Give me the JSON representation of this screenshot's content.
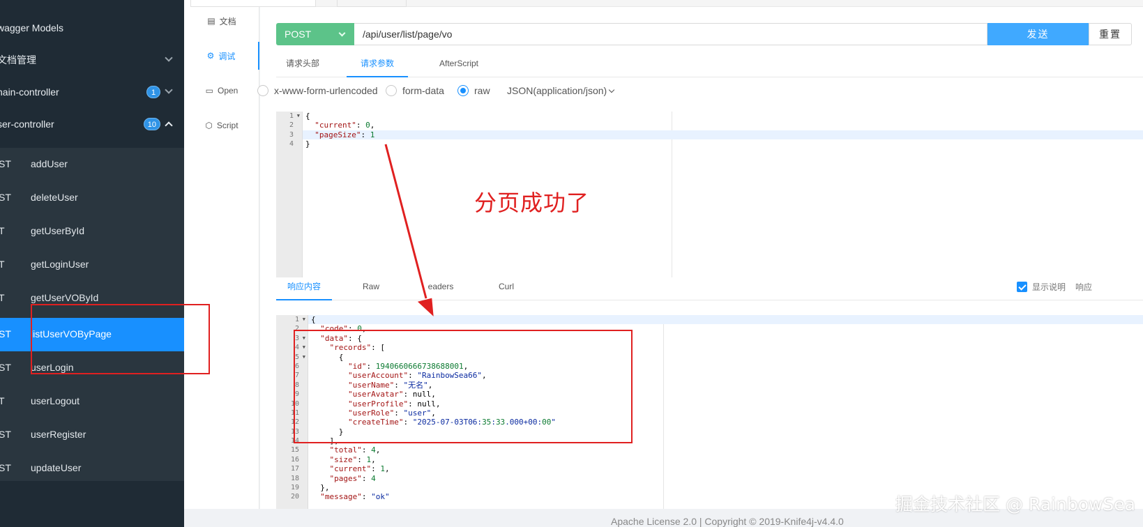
{
  "sidebar": {
    "groups": [
      {
        "label": "wagger Models"
      },
      {
        "label": "文档管理"
      },
      {
        "label": "nain-controller",
        "badge": "1"
      },
      {
        "label": "ser-controller",
        "badge": "10"
      }
    ],
    "apis": [
      {
        "method": "ST",
        "name": "addUser"
      },
      {
        "method": "ST",
        "name": "deleteUser"
      },
      {
        "method": "T",
        "name": "getUserById"
      },
      {
        "method": "T",
        "name": "getLoginUser"
      },
      {
        "method": "T",
        "name": "getUserVOById"
      },
      {
        "method": "ST",
        "name": "listUserVOByPage"
      },
      {
        "method": "ST",
        "name": "userLogin"
      },
      {
        "method": "T",
        "name": "userLogout"
      },
      {
        "method": "ST",
        "name": "userRegister"
      },
      {
        "method": "ST",
        "name": "updateUser"
      }
    ]
  },
  "side_tabs": [
    {
      "icon": "▤",
      "label": "文档"
    },
    {
      "icon": "⚙",
      "label": "调试"
    },
    {
      "icon": "▭",
      "label": "Open"
    },
    {
      "icon": "⬡",
      "label": "Script"
    }
  ],
  "request": {
    "method": "POST",
    "url": "/api/user/list/page/vo",
    "send_label": "发送",
    "reset_label": "重置"
  },
  "req_tabs": [
    "请求头部",
    "请求参数",
    "AfterScript"
  ],
  "body_types": [
    "x-www-form-urlencoded",
    "form-data",
    "raw",
    "JSON(application/json)"
  ],
  "request_body_lines": [
    "{",
    "  \"current\": 0,",
    "  \"pageSize\": 1",
    "}"
  ],
  "resp_tabs": [
    "响应内容",
    "Raw",
    "eaders",
    "Curl"
  ],
  "show_desc_label": "显示说明",
  "resp_extra_label": "响应",
  "response_lines": [
    "{",
    "  \"code\": 0,",
    "  \"data\": {",
    "    \"records\": [",
    "      {",
    "        \"id\": 1940660666738688001,",
    "        \"userAccount\": \"RainbowSea66\",",
    "        \"userName\": \"无名\",",
    "        \"userAvatar\": null,",
    "        \"userProfile\": null,",
    "        \"userRole\": \"user\",",
    "        \"createTime\": \"2025-07-03T06:35:33.000+00:00\"",
    "      }",
    "    ],",
    "    \"total\": 4,",
    "    \"size\": 1,",
    "    \"current\": 1,",
    "    \"pages\": 4",
    "  },",
    "  \"message\": \"ok\""
  ],
  "annotation": "分页成功了",
  "footer": "Apache License 2.0 | Copyright © 2019-Knife4j-v4.4.0",
  "watermark": "掘金技术社区 @ RainbowSea",
  "colors": {
    "accent": "#1890ff",
    "post": "#5cc389",
    "send": "#40a9ff",
    "annotation": "#e02020",
    "sidebar": "#1f2b35"
  }
}
